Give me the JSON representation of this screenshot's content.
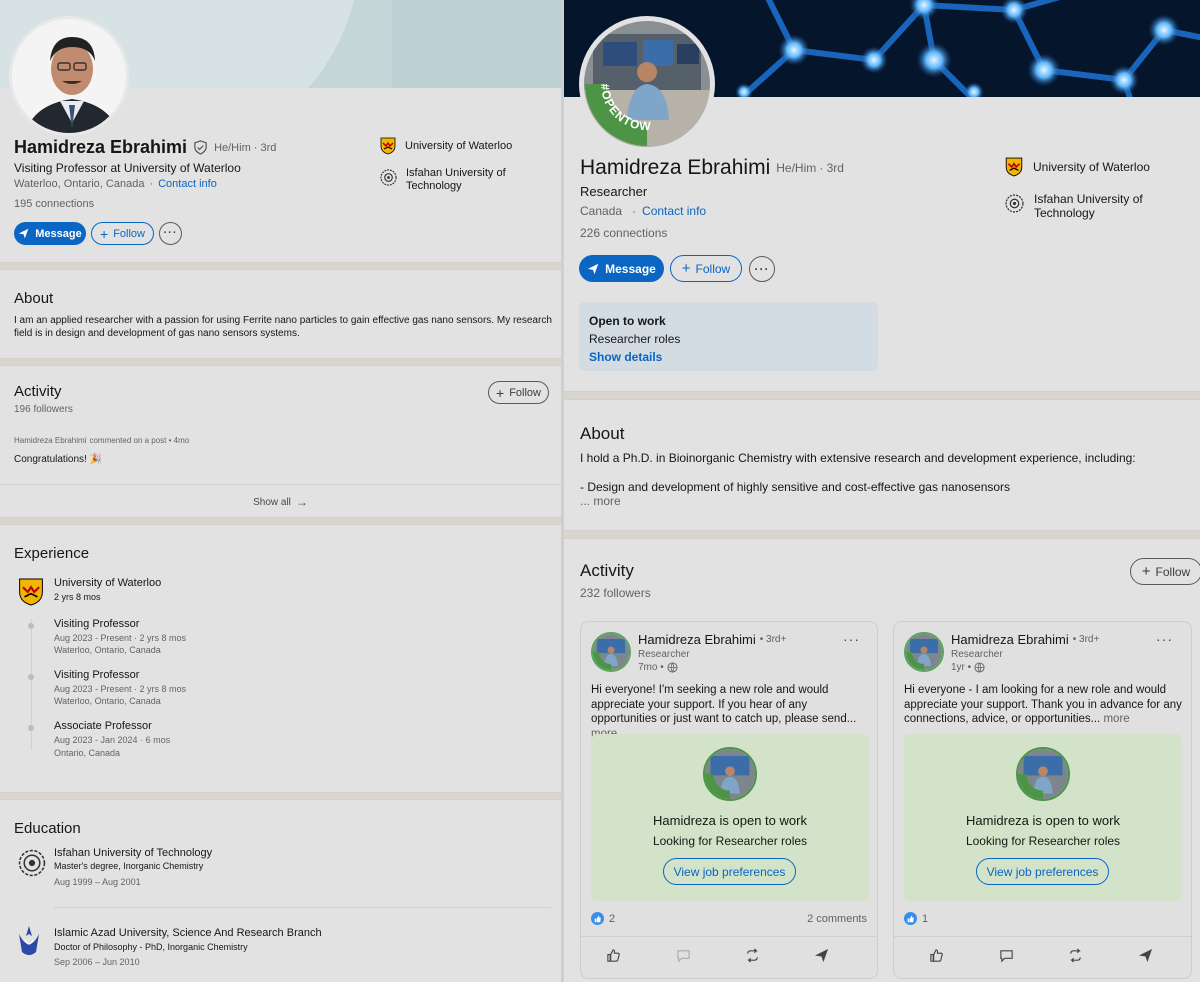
{
  "left": {
    "profile": {
      "name": "Hamidreza Ebrahimi",
      "pronouns": "He/Him",
      "degree": "· 3rd",
      "headline": "Visiting Professor at University of Waterloo",
      "location": "Waterloo, Ontario, Canada",
      "location_sep": "·",
      "contact_info": "Contact info",
      "connections": "195 connections",
      "message_label": "Message",
      "follow_label": "Follow"
    },
    "top_orgs": [
      "University of Waterloo",
      "Isfahan University of Technology"
    ],
    "about": {
      "heading": "About",
      "text": "I am an applied researcher with a passion for using Ferrite nano particles to gain effective gas nano sensors. My research field is in design and development of gas nano sensors systems."
    },
    "activity": {
      "heading": "Activity",
      "followers": "196 followers",
      "follow_label": "Follow",
      "post_author": "Hamidreza Ebrahimi",
      "post_meta": "commented on a post • 4mo",
      "post_text": "Congratulations! 🎉",
      "show_all": "Show all"
    },
    "experience": {
      "heading": "Experience",
      "company": "University of Waterloo",
      "duration": "2 yrs 8 mos",
      "roles": [
        {
          "title": "Visiting Professor",
          "dates": "Aug 2023 - Present · 2 yrs 8 mos",
          "location": "Waterloo, Ontario, Canada"
        },
        {
          "title": "Visiting Professor",
          "dates": "Aug 2023 - Present · 2 yrs 8 mos",
          "location": "Waterloo, Ontario, Canada"
        },
        {
          "title": "Associate Professor",
          "dates": "Aug 2023 - Jan 2024 · 6 mos",
          "location": "Ontario, Canada"
        }
      ]
    },
    "education": {
      "heading": "Education",
      "items": [
        {
          "school": "Isfahan University of Technology",
          "degree": "Master's degree, Inorganic Chemistry",
          "dates": "Aug 1999 – Aug 2001"
        },
        {
          "school": "Islamic Azad University, Science And Research Branch",
          "degree": "Doctor of Philosophy - PhD, Inorganic Chemistry",
          "dates": "Sep 2006 – Jun 2010"
        }
      ]
    }
  },
  "right": {
    "profile": {
      "name": "Hamidreza Ebrahimi",
      "pronouns": "He/Him",
      "degree": "· 3rd",
      "headline": "Researcher",
      "location": "Canada",
      "location_sep": "·",
      "contact_info": "Contact info",
      "connections": "226 connections",
      "message_label": "Message",
      "follow_label": "Follow",
      "badge_text": "#OPENTOWORK"
    },
    "top_orgs": [
      "University of Waterloo",
      "Isfahan University of Technology"
    ],
    "open_to_work": {
      "title": "Open to work",
      "roles": "Researcher roles",
      "show_details": "Show details"
    },
    "about": {
      "heading": "About",
      "line1": "I hold a Ph.D. in Bioinorganic Chemistry with extensive research and development experience, including:",
      "line2": "- Design and development of highly sensitive and cost-effective gas nanosensors",
      "more": "... more"
    },
    "activity": {
      "heading": "Activity",
      "followers": "232 followers",
      "follow_label": "Follow",
      "posts": [
        {
          "author": "Hamidreza Ebrahimi",
          "degree": "• 3rd+",
          "subtitle": "Researcher",
          "time": "7mo •",
          "text": "Hi everyone! I'm seeking a new role and would appreciate your support. If you hear of any opportunities or just want to catch up, please send...",
          "more": "more",
          "otw_title": "Hamidreza is open to work",
          "otw_sub": "Looking for Researcher roles",
          "otw_button": "View job preferences",
          "reactions": "2",
          "comments": "2 comments"
        },
        {
          "author": "Hamidreza Ebrahimi",
          "degree": "• 3rd+",
          "subtitle": "Researcher",
          "time": "1yr •",
          "text": "Hi everyone - I am looking for a new role and would appreciate your support. Thank you in advance for any connections, advice, or opportunities...",
          "more": "more",
          "otw_title": "Hamidreza is open to work",
          "otw_sub": "Looking for Researcher roles",
          "otw_button": "View job preferences",
          "reactions": "1",
          "comments": ""
        }
      ]
    }
  },
  "colors": {
    "accent": "#0a66c2",
    "open_to_work_green": "#57a55a",
    "otw_card_bg": "#d2e3c9",
    "banner_left": "#c5d6d9",
    "banner_right": "#061a33"
  },
  "icons": [
    "verified-shield-icon",
    "send-icon",
    "plus-icon",
    "ellipsis-icon",
    "arrow-right-icon",
    "globe-icon",
    "like-icon",
    "comment-icon",
    "repost-icon",
    "share-icon",
    "waterloo-crest-icon",
    "isfahan-seal-icon",
    "azad-logo-icon"
  ]
}
